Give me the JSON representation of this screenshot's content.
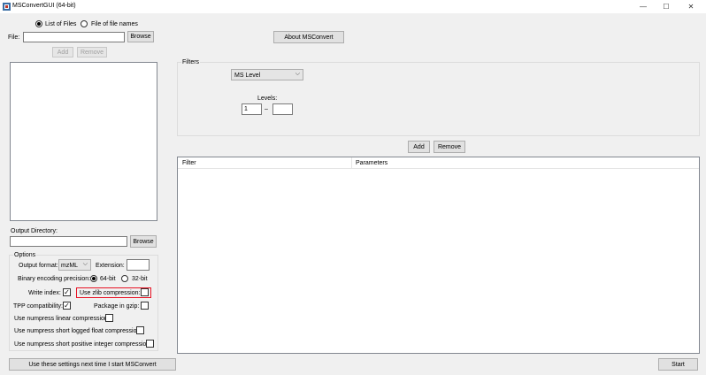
{
  "window": {
    "title": "MSConvertGUI (64-bit)",
    "controls": {
      "minimize": "—",
      "maximize": "☐",
      "close": "✕"
    }
  },
  "source": {
    "radio_list": "List of Files",
    "radio_file": "File of file names",
    "file_label": "File:",
    "file_value": "",
    "browse_label": "Browse",
    "add_label": "Add",
    "remove_label": "Remove"
  },
  "about_label": "About MSConvert",
  "filters": {
    "group_title": "Filters",
    "type_value": "MS Level",
    "levels_label": "Levels:",
    "level_from": "1",
    "level_sep": "–",
    "level_to": "",
    "add_label": "Add",
    "remove_label": "Remove",
    "table_headers": [
      "Filter",
      "Parameters"
    ]
  },
  "output": {
    "dir_label": "Output Directory:",
    "dir_value": "",
    "browse_label": "Browse"
  },
  "options": {
    "group_title": "Options",
    "format_label": "Output format:",
    "format_value": "mzML",
    "extension_label": "Extension:",
    "extension_value": "",
    "precision_label": "Binary encoding precision:",
    "precision_64": "64-bit",
    "precision_32": "32-bit",
    "write_index_label": "Write index:",
    "zlib_label": "Use zlib compression:",
    "tpp_label": "TPP compatibility:",
    "gzip_label": "Package in gzip:",
    "numpress_linear_label": "Use numpress linear compression:",
    "numpress_slof_label": "Use numpress short logged float compression:",
    "numpress_pic_label": "Use numpress short positive integer compression:",
    "check_mark": "✓"
  },
  "save_settings_label": "Use these settings next time I start MSConvert",
  "start_label": "Start",
  "colors": {
    "highlight": "#e81123"
  }
}
